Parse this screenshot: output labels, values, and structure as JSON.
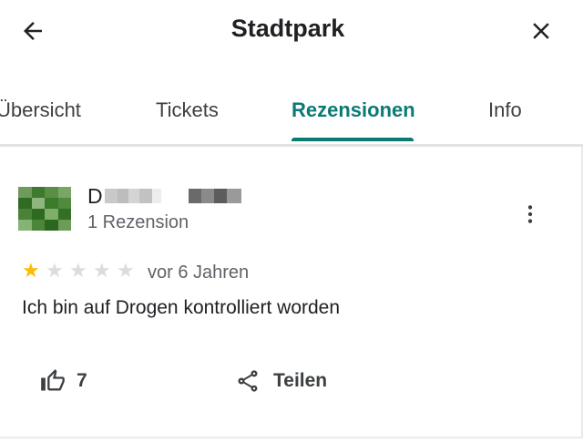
{
  "header": {
    "title": "Stadtpark",
    "back_icon": "arrow-left-icon",
    "close_icon": "close-icon"
  },
  "tabs": [
    {
      "label": "Übersicht",
      "active": false
    },
    {
      "label": "Tickets",
      "active": false
    },
    {
      "label": "Rezensionen",
      "active": true
    },
    {
      "label": "Info",
      "active": false
    }
  ],
  "colors": {
    "accent": "#0b7a73",
    "star_filled": "#fbbc04",
    "star_empty": "#dadce0"
  },
  "review": {
    "author_initial": "D",
    "author_review_count": "1 Rezension",
    "rating": 1,
    "max_rating": 5,
    "date": "vor 6 Jahren",
    "text": "Ich bin auf Drogen kontrolliert worden",
    "likes": "7",
    "share_label": "Teilen",
    "like_icon": "thumbs-up-icon",
    "share_icon": "share-icon",
    "more_icon": "more-vert-icon"
  }
}
